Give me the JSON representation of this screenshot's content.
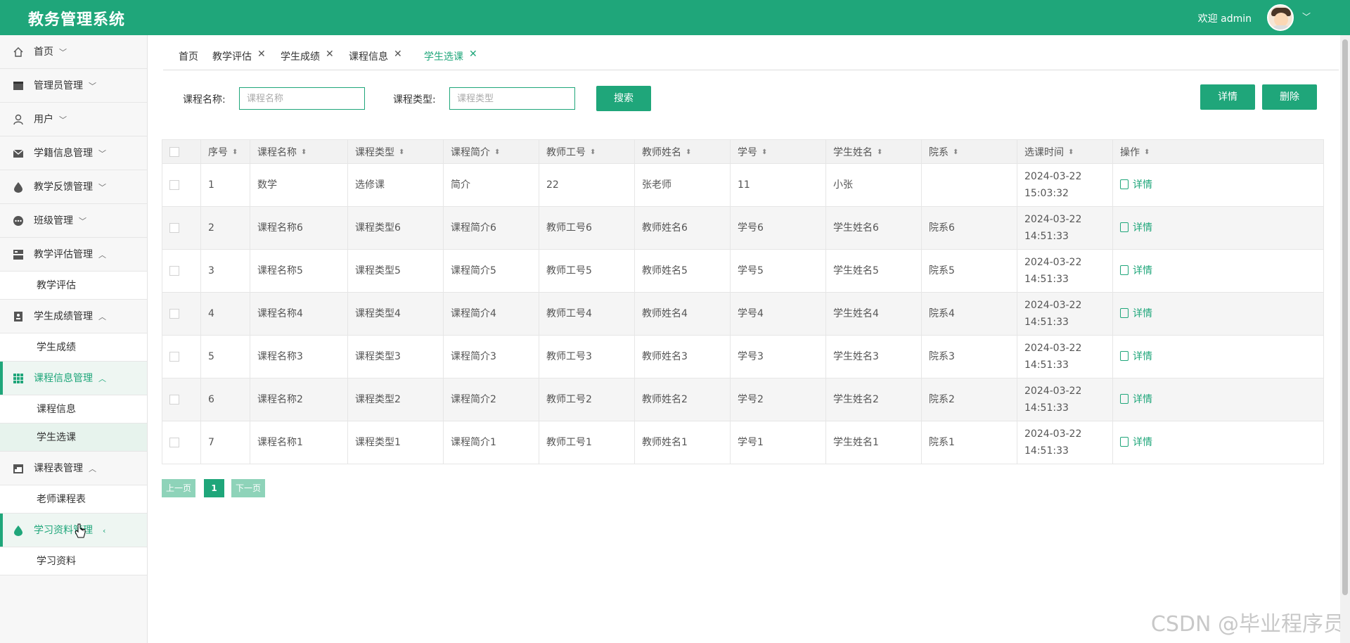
{
  "header": {
    "title": "教务管理系统",
    "welcome": "欢迎 admin",
    "bg_color": "#1fa67a"
  },
  "sidebar": {
    "items": [
      {
        "label": "首页",
        "icon": "home-icon",
        "arrow": "﹀"
      },
      {
        "label": "管理员管理",
        "icon": "admin-icon",
        "arrow": "﹀"
      },
      {
        "label": "用户",
        "icon": "user-icon",
        "arrow": "﹀"
      },
      {
        "label": "学籍信息管理",
        "icon": "mail-icon",
        "arrow": "﹀"
      },
      {
        "label": "教学反馈管理",
        "icon": "drop-icon",
        "arrow": "﹀"
      },
      {
        "label": "班级管理",
        "icon": "dots-icon",
        "arrow": "﹀"
      },
      {
        "label": "教学评估管理",
        "icon": "server-icon",
        "arrow": "︿"
      },
      {
        "label": "学生成绩管理",
        "icon": "contact-icon",
        "arrow": "︿"
      },
      {
        "label": "课程信息管理",
        "icon": "grid-icon",
        "arrow": "︿"
      },
      {
        "label": "课程表管理",
        "icon": "calendar-icon",
        "arrow": "︿"
      },
      {
        "label": "学习资料管理",
        "icon": "drop-icon",
        "arrow": "‹"
      }
    ],
    "sub": {
      "eval": "教学评估",
      "score": "学生成绩",
      "course_info": "课程信息",
      "course_select": "学生选课",
      "teacher_schedule": "老师课程表",
      "materials": "学习资料"
    }
  },
  "tabs": [
    {
      "label": "首页"
    },
    {
      "label": "教学评估"
    },
    {
      "label": "学生成绩"
    },
    {
      "label": "课程信息"
    },
    {
      "label": "学生选课"
    }
  ],
  "tab_close": "✕",
  "search": {
    "course_name_label": "课程名称:",
    "course_name_placeholder": "课程名称",
    "course_type_label": "课程类型:",
    "course_type_placeholder": "课程类型",
    "search_btn": "搜索",
    "detail_btn": "详情",
    "delete_btn": "删除"
  },
  "table": {
    "columns": [
      "序号",
      "课程名称",
      "课程类型",
      "课程简介",
      "教师工号",
      "教师姓名",
      "学号",
      "学生姓名",
      "院系",
      "选课时间",
      "操作"
    ],
    "op_label": "详情",
    "rows": [
      [
        "1",
        "数学",
        "选修课",
        "简介",
        "22",
        "张老师",
        "11",
        "小张",
        "",
        "2024-03-22 15:03:32"
      ],
      [
        "2",
        "课程名称6",
        "课程类型6",
        "课程简介6",
        "教师工号6",
        "教师姓名6",
        "学号6",
        "学生姓名6",
        "院系6",
        "2024-03-22 14:51:33"
      ],
      [
        "3",
        "课程名称5",
        "课程类型5",
        "课程简介5",
        "教师工号5",
        "教师姓名5",
        "学号5",
        "学生姓名5",
        "院系5",
        "2024-03-22 14:51:33"
      ],
      [
        "4",
        "课程名称4",
        "课程类型4",
        "课程简介4",
        "教师工号4",
        "教师姓名4",
        "学号4",
        "学生姓名4",
        "院系4",
        "2024-03-22 14:51:33"
      ],
      [
        "5",
        "课程名称3",
        "课程类型3",
        "课程简介3",
        "教师工号3",
        "教师姓名3",
        "学号3",
        "学生姓名3",
        "院系3",
        "2024-03-22 14:51:33"
      ],
      [
        "6",
        "课程名称2",
        "课程类型2",
        "课程简介2",
        "教师工号2",
        "教师姓名2",
        "学号2",
        "学生姓名2",
        "院系2",
        "2024-03-22 14:51:33"
      ],
      [
        "7",
        "课程名称1",
        "课程类型1",
        "课程简介1",
        "教师工号1",
        "教师姓名1",
        "学号1",
        "学生姓名1",
        "院系1",
        "2024-03-22 14:51:33"
      ]
    ]
  },
  "pagination": {
    "prev": "上一页",
    "current": "1",
    "next": "下一页"
  },
  "watermark": "CSDN @毕业程序员"
}
